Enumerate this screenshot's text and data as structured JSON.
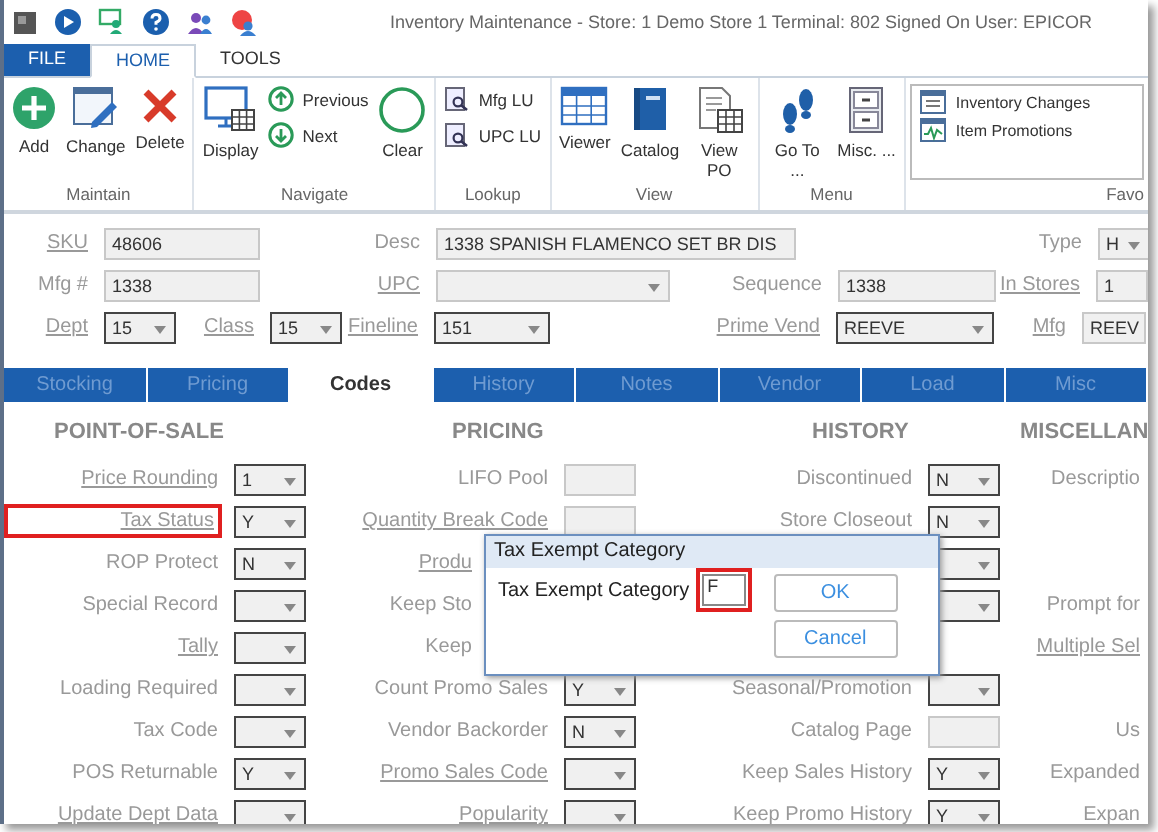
{
  "window": {
    "title": "Inventory Maintenance - Store: 1 Demo Store 1 Terminal: 802 Signed On User: EPICOR"
  },
  "ribbon_tabs": [
    {
      "label": "FILE",
      "kind": "file",
      "selected": false
    },
    {
      "label": "HOME",
      "kind": "tab",
      "selected": true
    },
    {
      "label": "TOOLS",
      "kind": "tab",
      "selected": false
    }
  ],
  "ribbon_groups": [
    {
      "label": "Maintain",
      "buttons": [
        {
          "label": "Add",
          "kind": "add"
        },
        {
          "label": "Change",
          "kind": "change"
        },
        {
          "label": "Delete",
          "kind": "delete"
        }
      ]
    },
    {
      "label": "Navigate",
      "buttons": [
        {
          "label": "Display",
          "kind": "display"
        },
        {
          "label": "Previous",
          "kind": "up"
        },
        {
          "label": "Next",
          "kind": "down"
        },
        {
          "label": "Clear",
          "kind": "clear"
        }
      ]
    },
    {
      "label": "Lookup",
      "buttons": [
        {
          "label": "Mfg LU",
          "kind": "lookup"
        },
        {
          "label": "UPC LU",
          "kind": "lookup"
        }
      ]
    },
    {
      "label": "View",
      "buttons": [
        {
          "label": "Viewer",
          "kind": "grid"
        },
        {
          "label": "Catalog",
          "kind": "book"
        },
        {
          "label": "View PO",
          "kind": "doc"
        }
      ]
    },
    {
      "label": "Menu",
      "buttons": [
        {
          "label": "Go To ...",
          "kind": "feet"
        },
        {
          "label": "Misc. ...",
          "kind": "cabinet"
        }
      ]
    }
  ],
  "favorites": {
    "label": "Favo",
    "items": [
      {
        "label": "Inventory Changes",
        "kind": "form"
      },
      {
        "label": "Item Promotions",
        "kind": "chart"
      }
    ]
  },
  "header_rows": [
    [
      {
        "label": "SKU",
        "underlined": true,
        "kind": "text",
        "value": "48606"
      },
      {
        "label": "Desc",
        "underlined": false,
        "kind": "text",
        "value": "1338 SPANISH FLAMENCO SET BR DIS"
      },
      {
        "label": "Type",
        "underlined": false,
        "kind": "dropdown",
        "value": "H"
      }
    ],
    [
      {
        "label": "Mfg #",
        "underlined": false,
        "kind": "text",
        "value": "1338"
      },
      {
        "label": "UPC",
        "underlined": true,
        "kind": "dropdown"
      },
      {
        "label": "Sequence",
        "underlined": false,
        "kind": "text",
        "value": "1338"
      },
      {
        "label": "In Stores",
        "underlined": true,
        "kind": "text",
        "value": "1"
      }
    ],
    [
      {
        "label": "Dept",
        "underlined": true,
        "kind": "dropdown",
        "value": "15"
      },
      {
        "label": "Class",
        "underlined": true,
        "kind": "dropdown",
        "value": "15"
      },
      {
        "label": "Fineline",
        "underlined": true,
        "kind": "dropdown",
        "value": "151"
      },
      {
        "label": "Prime Vend",
        "underlined": true,
        "kind": "dropdown",
        "value": "REEVE"
      },
      {
        "label": "Mfg",
        "underlined": true,
        "kind": "text",
        "value": "REEV"
      }
    ]
  ],
  "content_tabs": [
    {
      "label": "Stocking",
      "selected": false
    },
    {
      "label": "Pricing",
      "selected": false
    },
    {
      "label": "Codes",
      "selected": true
    },
    {
      "label": "History",
      "selected": false
    },
    {
      "label": "Notes",
      "selected": false
    },
    {
      "label": "Vendor",
      "selected": false
    },
    {
      "label": "Load",
      "selected": false
    },
    {
      "label": "Misc",
      "selected": false
    }
  ],
  "columns": [
    {
      "heading": "POINT-OF-SALE",
      "rows": [
        {
          "label": "Price Rounding",
          "underlined": true,
          "kind": "dropdown",
          "value": "1",
          "highlighted": false
        },
        {
          "label": "Tax Status",
          "underlined": true,
          "kind": "dropdown",
          "value": "Y",
          "highlighted": true
        },
        {
          "label": "ROP Protect",
          "underlined": false,
          "kind": "dropdown",
          "value": "N",
          "highlighted": false
        },
        {
          "label": "Special Record",
          "underlined": false,
          "kind": "dropdown",
          "highlighted": false
        },
        {
          "label": "Tally",
          "underlined": true,
          "kind": "dropdown",
          "highlighted": false
        },
        {
          "label": "Loading Required",
          "underlined": false,
          "kind": "dropdown",
          "highlighted": false
        },
        {
          "label": "Tax Code",
          "underlined": false,
          "kind": "dropdown",
          "highlighted": false
        },
        {
          "label": "POS Returnable",
          "underlined": false,
          "kind": "dropdown",
          "value": "Y",
          "highlighted": false
        },
        {
          "label": "Update Dept Data",
          "underlined": true,
          "kind": "dropdown",
          "highlighted": false
        }
      ]
    },
    {
      "heading": "PRICING",
      "rows": [
        {
          "label": "LIFO Pool",
          "underlined": false,
          "kind": "text"
        },
        {
          "label": "Quantity Break Code",
          "underlined": true,
          "kind": "text"
        },
        {
          "label": "Produ",
          "underlined": true,
          "kind": "covered"
        },
        {
          "label": "Keep Sto",
          "underlined": false,
          "kind": "covered"
        },
        {
          "label": "Keep",
          "underlined": false,
          "kind": "covered"
        },
        {
          "label": "Count Promo Sales",
          "underlined": false,
          "kind": "dropdown",
          "value": "Y"
        },
        {
          "label": "Vendor Backorder",
          "underlined": false,
          "kind": "dropdown",
          "value": "N"
        },
        {
          "label": "Promo Sales Code",
          "underlined": true,
          "kind": "dropdown"
        },
        {
          "label": "Popularity",
          "underlined": true,
          "kind": "dropdown"
        }
      ]
    },
    {
      "heading": "HISTORY",
      "rows": [
        {
          "label": "Discontinued",
          "underlined": false,
          "kind": "dropdown",
          "value": "N"
        },
        {
          "label": "Store Closeout",
          "underlined": false,
          "kind": "dropdown",
          "value": "N"
        },
        {
          "kind": "dropdown"
        },
        {
          "kind": "dropdown"
        },
        {
          "kind": "blank"
        },
        {
          "label": "Seasonal/Promotion",
          "underlined": false,
          "kind": "dropdown"
        },
        {
          "label": "Catalog Page",
          "underlined": false,
          "kind": "text"
        },
        {
          "label": "Keep Sales History",
          "underlined": false,
          "kind": "dropdown",
          "value": "Y"
        },
        {
          "label": "Keep Promo History",
          "underlined": false,
          "kind": "dropdown",
          "value": "Y"
        }
      ]
    },
    {
      "heading": "MISCELLAN",
      "rows": [
        {
          "label": "Descriptio",
          "underlined": false,
          "kind": "label"
        },
        {
          "kind": "blank"
        },
        {
          "kind": "blank"
        },
        {
          "label": "Prompt for",
          "underlined": false,
          "kind": "label"
        },
        {
          "label": "Multiple Sel",
          "underlined": true,
          "kind": "label"
        },
        {
          "kind": "blank"
        },
        {
          "label": "Us",
          "underlined": false,
          "kind": "label"
        },
        {
          "label": "Expanded",
          "underlined": false,
          "kind": "label"
        },
        {
          "label": "Expan",
          "underlined": false,
          "kind": "label"
        }
      ]
    }
  ],
  "dialog": {
    "title": "Tax Exempt Category",
    "field": {
      "label": "Tax Exempt Category",
      "value": "F",
      "highlighted": true
    },
    "buttons": [
      "OK",
      "Cancel"
    ]
  }
}
